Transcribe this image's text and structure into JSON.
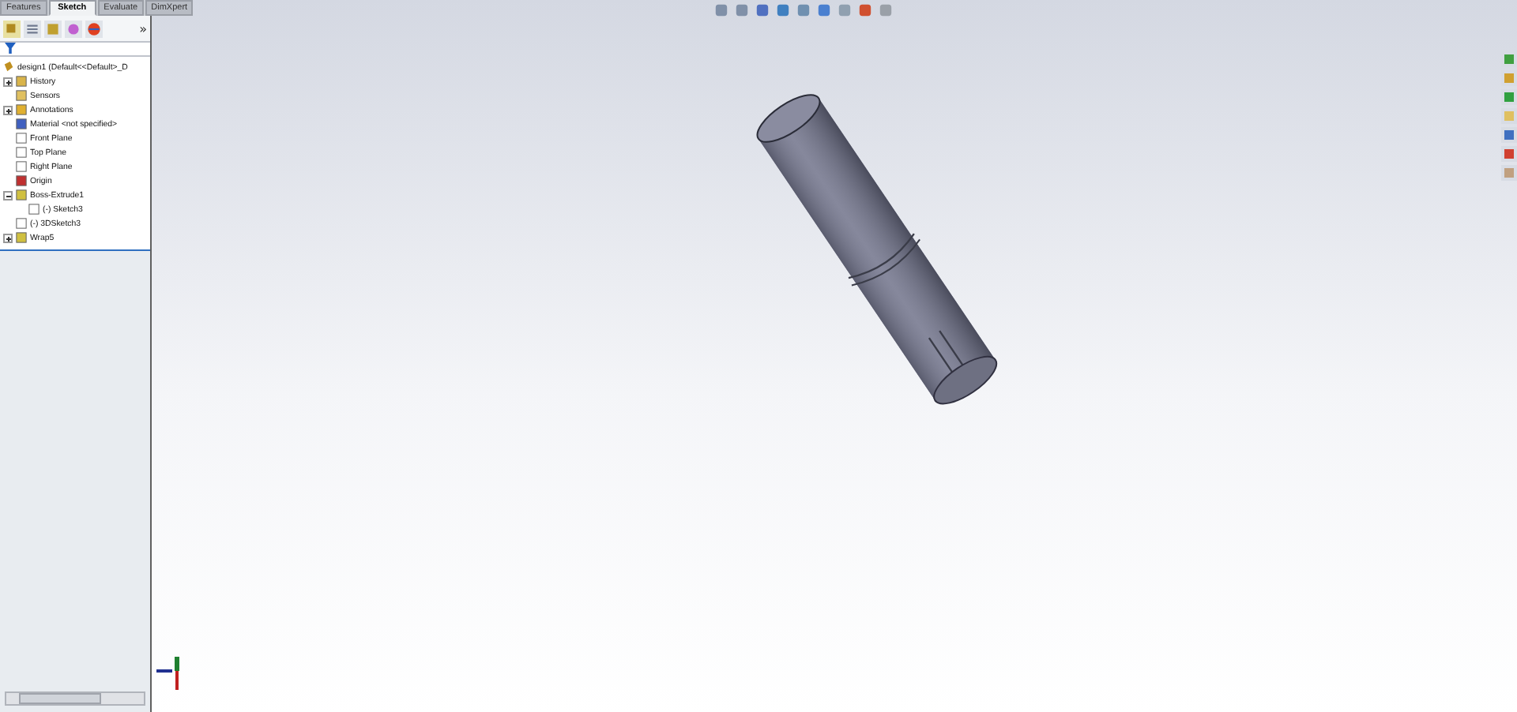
{
  "tabs": [
    {
      "label": "Features",
      "selected": false
    },
    {
      "label": "Sketch",
      "selected": true
    },
    {
      "label": "Evaluate",
      "selected": false
    },
    {
      "label": "DimXpert",
      "selected": false
    }
  ],
  "panel_toolbar": {
    "overflow": "»"
  },
  "tree": {
    "root": "design1  (Default<<Default>_D",
    "items": [
      {
        "label": "History",
        "kind": "folder",
        "expandable": true,
        "expanded": false
      },
      {
        "label": "Sensors",
        "kind": "sensor",
        "expandable": false
      },
      {
        "label": "Annotations",
        "kind": "annotation",
        "expandable": true,
        "expanded": false
      },
      {
        "label": "Material <not specified>",
        "kind": "material",
        "expandable": false
      },
      {
        "label": "Front Plane",
        "kind": "plane",
        "expandable": false
      },
      {
        "label": "Top Plane",
        "kind": "plane",
        "expandable": false
      },
      {
        "label": "Right Plane",
        "kind": "plane",
        "expandable": false
      },
      {
        "label": "Origin",
        "kind": "origin",
        "expandable": false
      },
      {
        "label": "Boss-Extrude1",
        "kind": "feature",
        "expandable": true,
        "expanded": true,
        "children": [
          {
            "label": "(-) Sketch3",
            "kind": "sketch",
            "expandable": false
          }
        ]
      },
      {
        "label": "(-) 3DSketch3",
        "kind": "sketch3d",
        "expandable": false
      },
      {
        "label": "Wrap5",
        "kind": "feature",
        "expandable": true,
        "expanded": false
      }
    ]
  }
}
